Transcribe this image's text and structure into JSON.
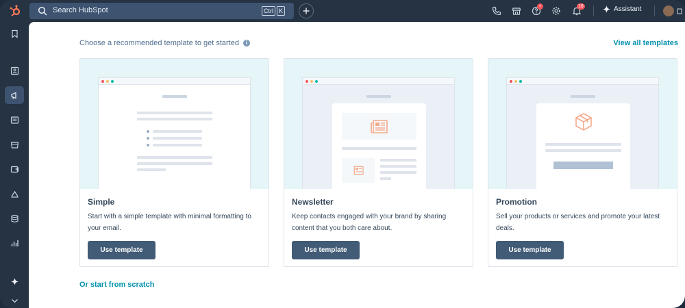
{
  "topbar": {
    "search_placeholder": "Search HubSpot",
    "kbd_ctrl": "Ctrl",
    "kbd_k": "K",
    "notifications_count": "16",
    "help_badge": "•",
    "assistant_label": "Assistant"
  },
  "colors": {
    "nav_bg": "#253342",
    "accent_link": "#0091ae",
    "button_bg": "#425b76",
    "preview_bg": "#e5f5f8",
    "badge": "#f2545b",
    "illustration_orange": "#f5a98a"
  },
  "sidebar": {
    "items": [
      {
        "icon": "bookmark-icon"
      },
      {
        "icon": "contacts-icon"
      },
      {
        "icon": "marketing-icon",
        "active": true
      },
      {
        "icon": "content-icon"
      },
      {
        "icon": "commerce-icon"
      },
      {
        "icon": "service-icon"
      },
      {
        "icon": "automation-icon"
      },
      {
        "icon": "data-icon"
      },
      {
        "icon": "reporting-icon"
      },
      {
        "icon": "breeze-icon"
      },
      {
        "icon": "chevron-down-icon"
      }
    ]
  },
  "main": {
    "hint": "Choose a recommended template to get started",
    "view_all": "View all templates",
    "templates": [
      {
        "title": "Simple",
        "description": "Start with a simple template with minimal formatting to your email.",
        "button": "Use template"
      },
      {
        "title": "Newsletter",
        "description": "Keep contacts engaged with your brand by sharing content that you both care about.",
        "button": "Use template"
      },
      {
        "title": "Promotion",
        "description": "Sell your products or services and promote your latest deals.",
        "button": "Use template"
      }
    ],
    "scratch_link": "Or start from scratch"
  }
}
